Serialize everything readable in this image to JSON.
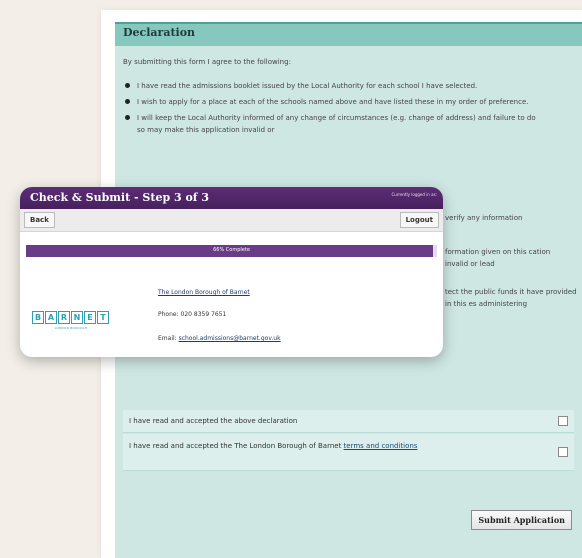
{
  "declaration": {
    "heading": "Declaration",
    "intro": "By submitting this form I agree to the following:",
    "bullets": [
      "I have read the admissions booklet issued by the Local Authority for each school I have selected.",
      "I wish to apply for a place at each of the schools named above and have listed these in my order of preference.",
      "I will keep the Local Authority informed of any change of circumstances (e.g. change of address) and failure to do so may make this application invalid or",
      "verify any information",
      "formation given on this cation invalid or lead",
      "tect the public funds it have provided in this es administering"
    ]
  },
  "agree": {
    "declaration_text": "I have read and accepted the above declaration",
    "terms_prefix": "I have read and accepted the The London Borough of Barnet ",
    "terms_link": "terms and conditions"
  },
  "submit_label": "Submit Application",
  "card": {
    "title": "Check & Submit - Step 3 of 3",
    "logged_in": "Currently logged in as:",
    "back_label": "Back",
    "logout_label": "Logout",
    "progress_label": "66% Complete",
    "progress_fraction": 0.99,
    "logo_letters": [
      "B",
      "A",
      "R",
      "N",
      "E",
      "T"
    ],
    "logo_sub": "LONDON BOROUGH",
    "borough_name": "The London Borough of Barnet",
    "phone": "Phone: 020 8359 7651",
    "email_prefix": "Email: ",
    "email_link": "school.admissions@barnet.gov.uk"
  },
  "colors": {
    "card_header": "#5d2d77",
    "declaration_bg": "#cfe7e3",
    "logo": "#2f9fb6"
  }
}
